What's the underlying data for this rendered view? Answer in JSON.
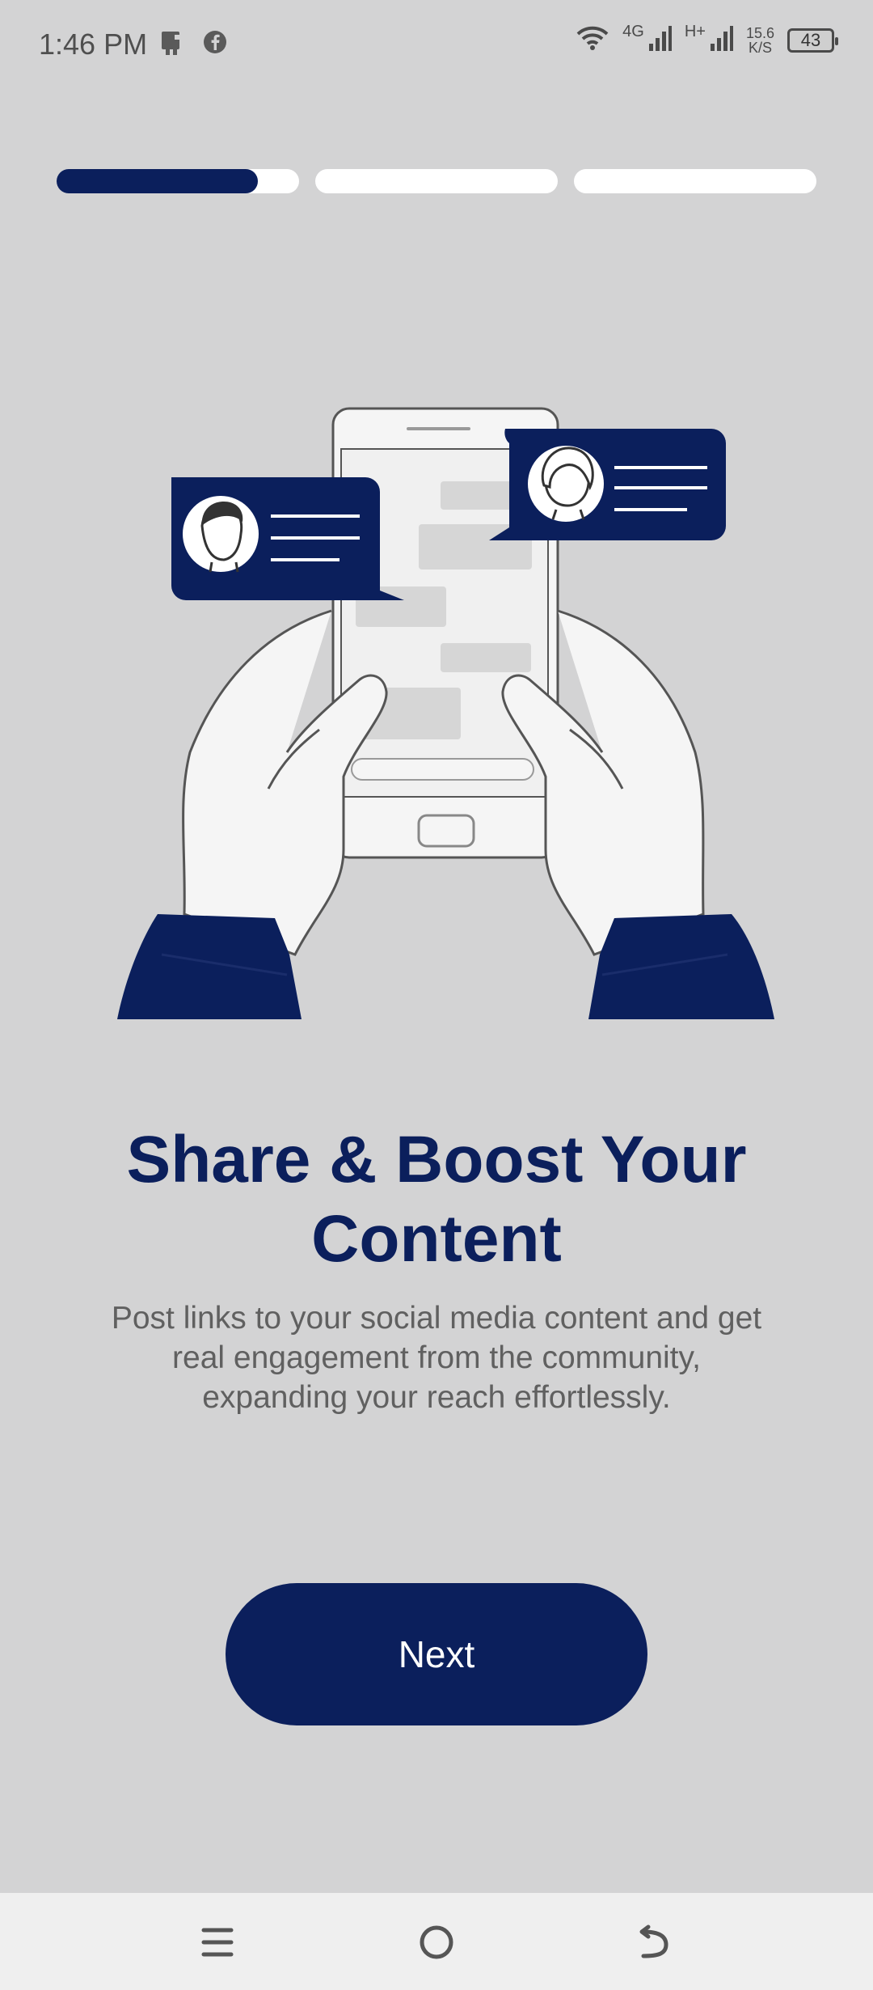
{
  "status_bar": {
    "time": "1:46 PM",
    "network_type_1": "4G",
    "network_type_2": "H+",
    "speed_value": "15.6",
    "speed_unit": "K/S",
    "battery_level": "43"
  },
  "onboarding": {
    "step_progress": [
      0.83,
      0,
      0
    ],
    "title": "Share & Boost Your Content",
    "description": "Post links to your social media content and get real engagement from the community, expanding your reach effortlessly.",
    "next_label": "Next"
  },
  "colors": {
    "accent": "#0b1f5c",
    "background": "#d3d3d4",
    "text_secondary": "#606060"
  },
  "icons": {
    "left_status": [
      "sim-card-icon",
      "facebook-icon"
    ],
    "right_status": [
      "wifi-icon",
      "signal-icon",
      "signal-icon",
      "battery-icon"
    ],
    "navigation": [
      "menu-icon",
      "home-circle-icon",
      "back-icon"
    ]
  }
}
